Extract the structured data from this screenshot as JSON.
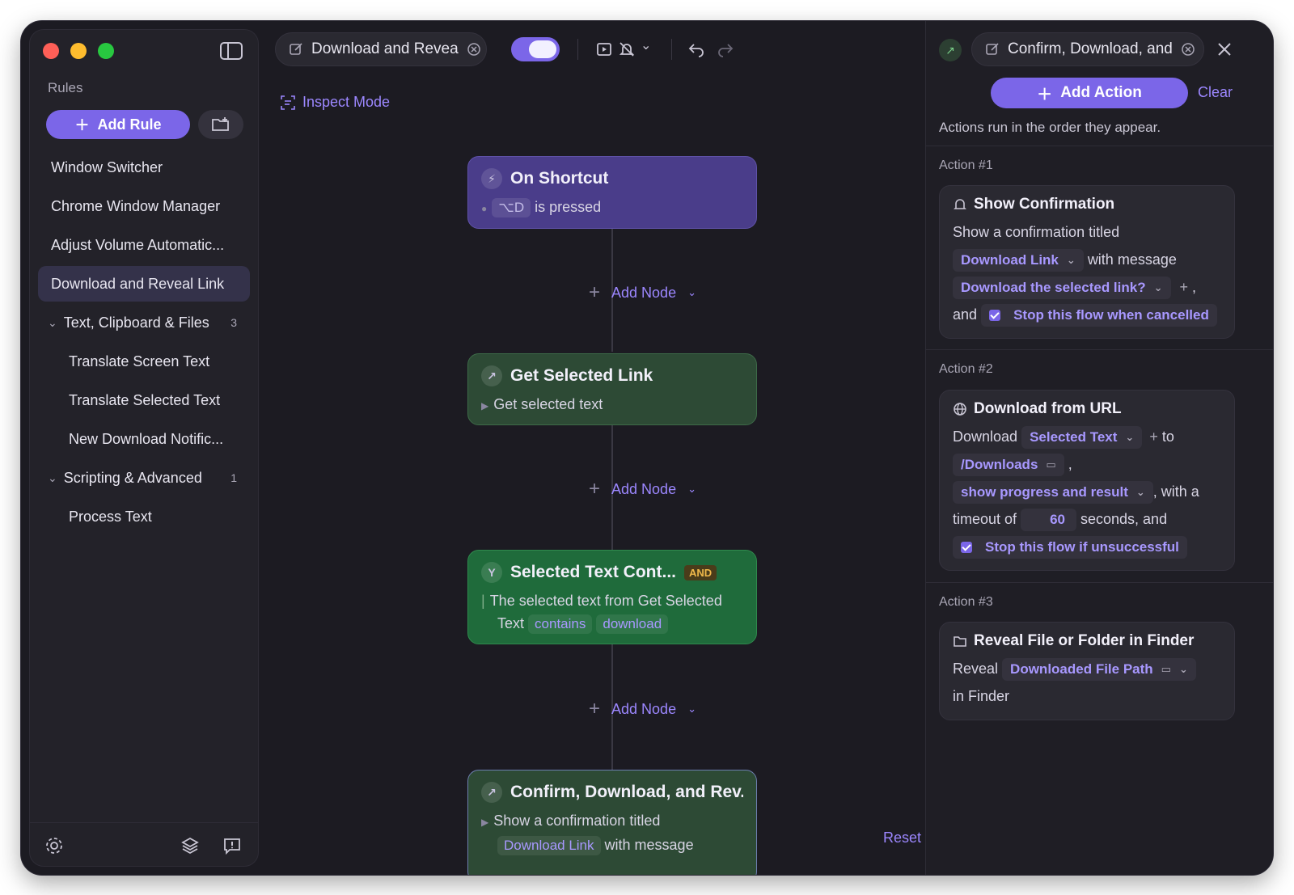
{
  "sidebar": {
    "rules_label": "Rules",
    "add_rule_label": "Add Rule",
    "items": [
      {
        "label": "Window Switcher"
      },
      {
        "label": "Chrome Window Manager"
      },
      {
        "label": "Adjust Volume Automatic..."
      },
      {
        "label": "Download and Reveal Link"
      }
    ],
    "groups": [
      {
        "label": "Text, Clipboard & Files",
        "count": "3",
        "children": [
          "Translate Screen Text",
          "Translate Selected Text",
          "New Download Notific..."
        ]
      },
      {
        "label": "Scripting & Advanced",
        "count": "1",
        "children": [
          "Process Text"
        ]
      }
    ]
  },
  "canvas": {
    "rule_title": "Download and Revea",
    "inspect_mode_label": "Inspect Mode",
    "add_node_label": "Add Node",
    "reset_label": "Reset",
    "nodes": [
      {
        "title": "On Shortcut",
        "key": "⌥D",
        "text": "is pressed"
      },
      {
        "title": "Get Selected Link",
        "text": "Get selected text"
      },
      {
        "title": "Selected Text Cont...",
        "badge": "AND",
        "text": "The selected text from Get Selected",
        "text2": "Text",
        "op": "contains",
        "value": "download"
      },
      {
        "title": "Confirm, Download, and Rev...",
        "text": "Show a confirmation titled",
        "pill": "Download Link",
        "text2": "with message"
      }
    ]
  },
  "panel": {
    "title": "Confirm, Download, and",
    "add_action_label": "Add Action",
    "clear_label": "Clear",
    "hint": "Actions run in the order they appear.",
    "actions": [
      {
        "label": "Action #1",
        "title": "Show Confirmation",
        "line1": "Show a confirmation titled",
        "field1": "Download Link",
        "with_message": "with message",
        "field2": "Download the selected link?",
        "and": "and",
        "check": "Stop this flow when cancelled"
      },
      {
        "label": "Action #2",
        "title": "Download from URL",
        "download": "Download",
        "field1": "Selected Text",
        "to": "to",
        "path": "/Downloads",
        "field2": "show progress and result",
        "with_a": ", with a",
        "timeout_of": "timeout of",
        "timeout": "60",
        "seconds_and": "seconds, and",
        "check": "Stop this flow if unsuccessful"
      },
      {
        "label": "Action #3",
        "title": "Reveal File or Folder in Finder",
        "reveal": "Reveal",
        "field1": "Downloaded File Path",
        "in_finder": "in Finder"
      }
    ]
  }
}
